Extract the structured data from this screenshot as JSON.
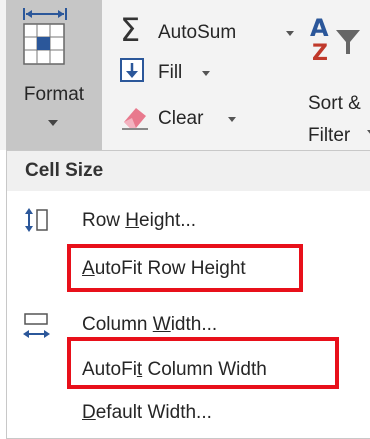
{
  "ribbon": {
    "format_button": {
      "label": "Format",
      "icon": "format-cells-icon"
    },
    "editing": [
      {
        "label": "AutoSum",
        "icon": "sigma-icon",
        "has_dropdown": true
      },
      {
        "label": "Fill",
        "icon": "fill-down-icon",
        "has_dropdown": true
      },
      {
        "label": "Clear",
        "icon": "eraser-icon",
        "has_dropdown": true
      }
    ],
    "sort_filter": {
      "line1": "Sort &",
      "line2": "Filter",
      "icon": "sort-filter-icon"
    }
  },
  "menu": {
    "cell_size_header": "Cell Size",
    "items": [
      {
        "before": "Row ",
        "accel": "H",
        "after": "eight...",
        "icon": "row-height-icon",
        "highlighted": false
      },
      {
        "before": "",
        "accel": "A",
        "after": "utoFit Row Height",
        "icon": "",
        "highlighted": true
      },
      {
        "before": "Column ",
        "accel": "W",
        "after": "idth...",
        "icon": "column-width-icon",
        "highlighted": false
      },
      {
        "before": "AutoFi",
        "accel": "t",
        "after": " Column Width",
        "icon": "",
        "highlighted": true
      },
      {
        "before": "",
        "accel": "D",
        "after": "efault Width...",
        "icon": "",
        "highlighted": false
      }
    ]
  },
  "colors": {
    "highlight_border": "#e8101a",
    "selected_button": "#c6c6c6",
    "accent_blue": "#2b579a"
  }
}
